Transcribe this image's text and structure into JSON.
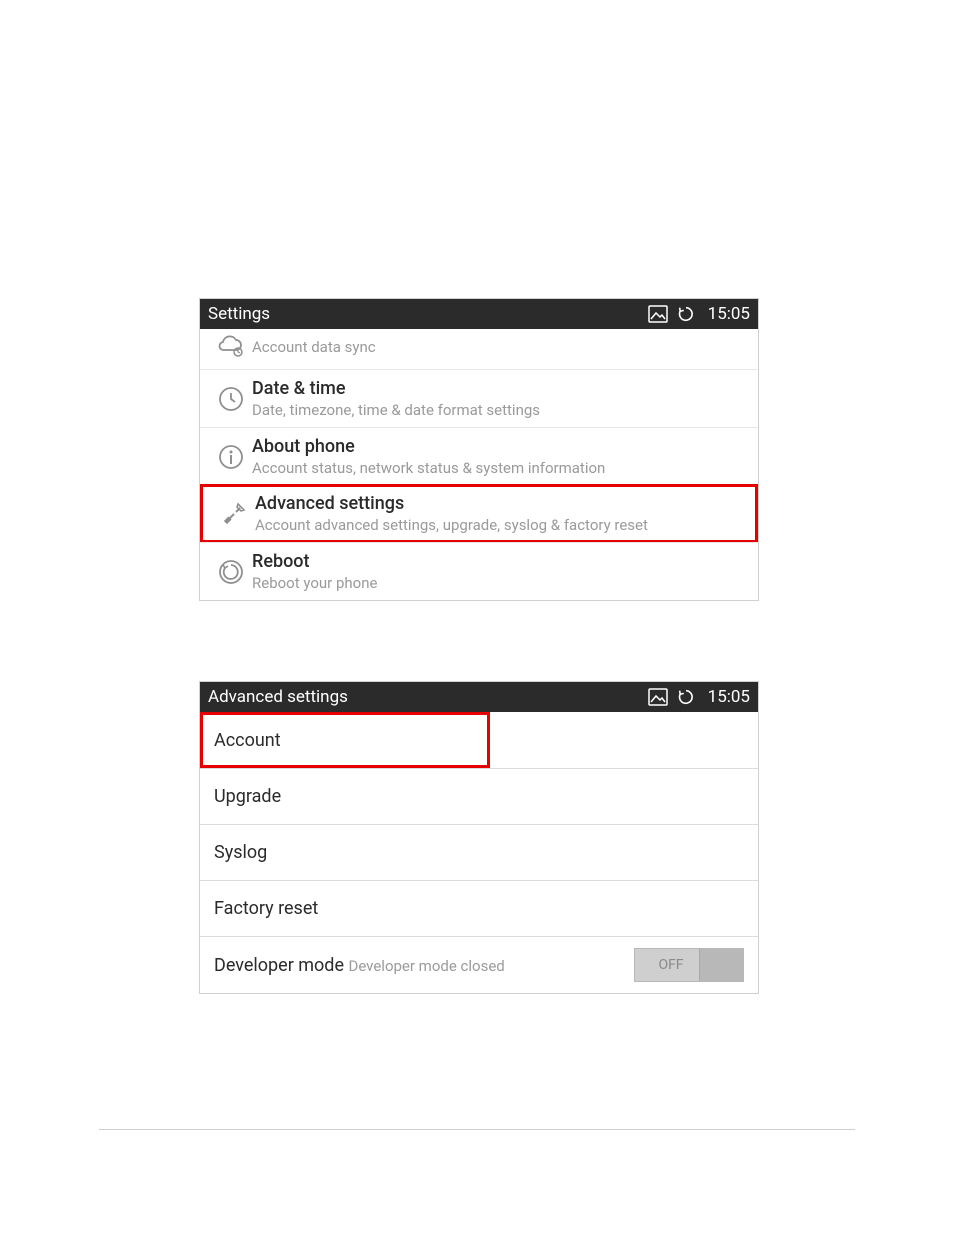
{
  "panel1": {
    "title": "Settings",
    "time": "15:05",
    "items": [
      {
        "primary": "",
        "secondary": "Account data sync"
      },
      {
        "primary": "Date & time",
        "secondary": "Date, timezone, time & date format settings"
      },
      {
        "primary": "About phone",
        "secondary": "Account status, network status & system information"
      },
      {
        "primary": "Advanced settings",
        "secondary": "Account advanced settings, upgrade, syslog & factory reset"
      },
      {
        "primary": "Reboot",
        "secondary": "Reboot your phone"
      }
    ]
  },
  "panel2": {
    "title": "Advanced settings",
    "time": "15:05",
    "items": [
      {
        "primary": "Account"
      },
      {
        "primary": "Upgrade"
      },
      {
        "primary": "Syslog"
      },
      {
        "primary": "Factory reset"
      },
      {
        "primary": "Developer mode",
        "secondary": "Developer mode closed",
        "toggle": "OFF"
      }
    ]
  }
}
